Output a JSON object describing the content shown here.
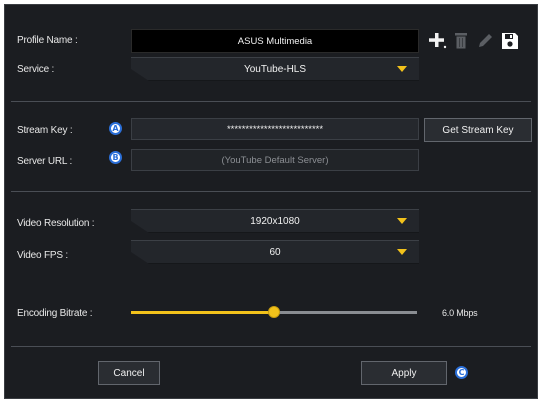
{
  "profile": {
    "name_label": "Profile Name :",
    "name_value": "ASUS Multimedia",
    "service_label": "Service :",
    "service_value": "YouTube-HLS"
  },
  "toolbar": {
    "add_icon": "plus-icon",
    "delete_icon": "trash-icon",
    "edit_icon": "pencil-icon",
    "save_icon": "floppy-disk-icon"
  },
  "stream": {
    "key_label": "Stream Key :",
    "key_value": "**************************",
    "key_badge": "A",
    "get_key_button": "Get Stream Key",
    "server_label": "Server URL :",
    "server_placeholder": "(YouTube Default Server)",
    "server_badge": "B"
  },
  "video": {
    "resolution_label": "Video Resolution :",
    "resolution_value": "1920x1080",
    "fps_label": "Video FPS :",
    "fps_value": "60"
  },
  "encoding": {
    "bitrate_label": "Encoding Bitrate :",
    "bitrate_value": "6.0 Mbps",
    "bitrate_level_fraction": 0.5
  },
  "footer": {
    "cancel_button": "Cancel",
    "apply_button": "Apply",
    "apply_badge": "C"
  },
  "colors": {
    "accent": "#f2c21b",
    "badge_blue": "#2b6fd8",
    "background": "#1b1d21"
  }
}
